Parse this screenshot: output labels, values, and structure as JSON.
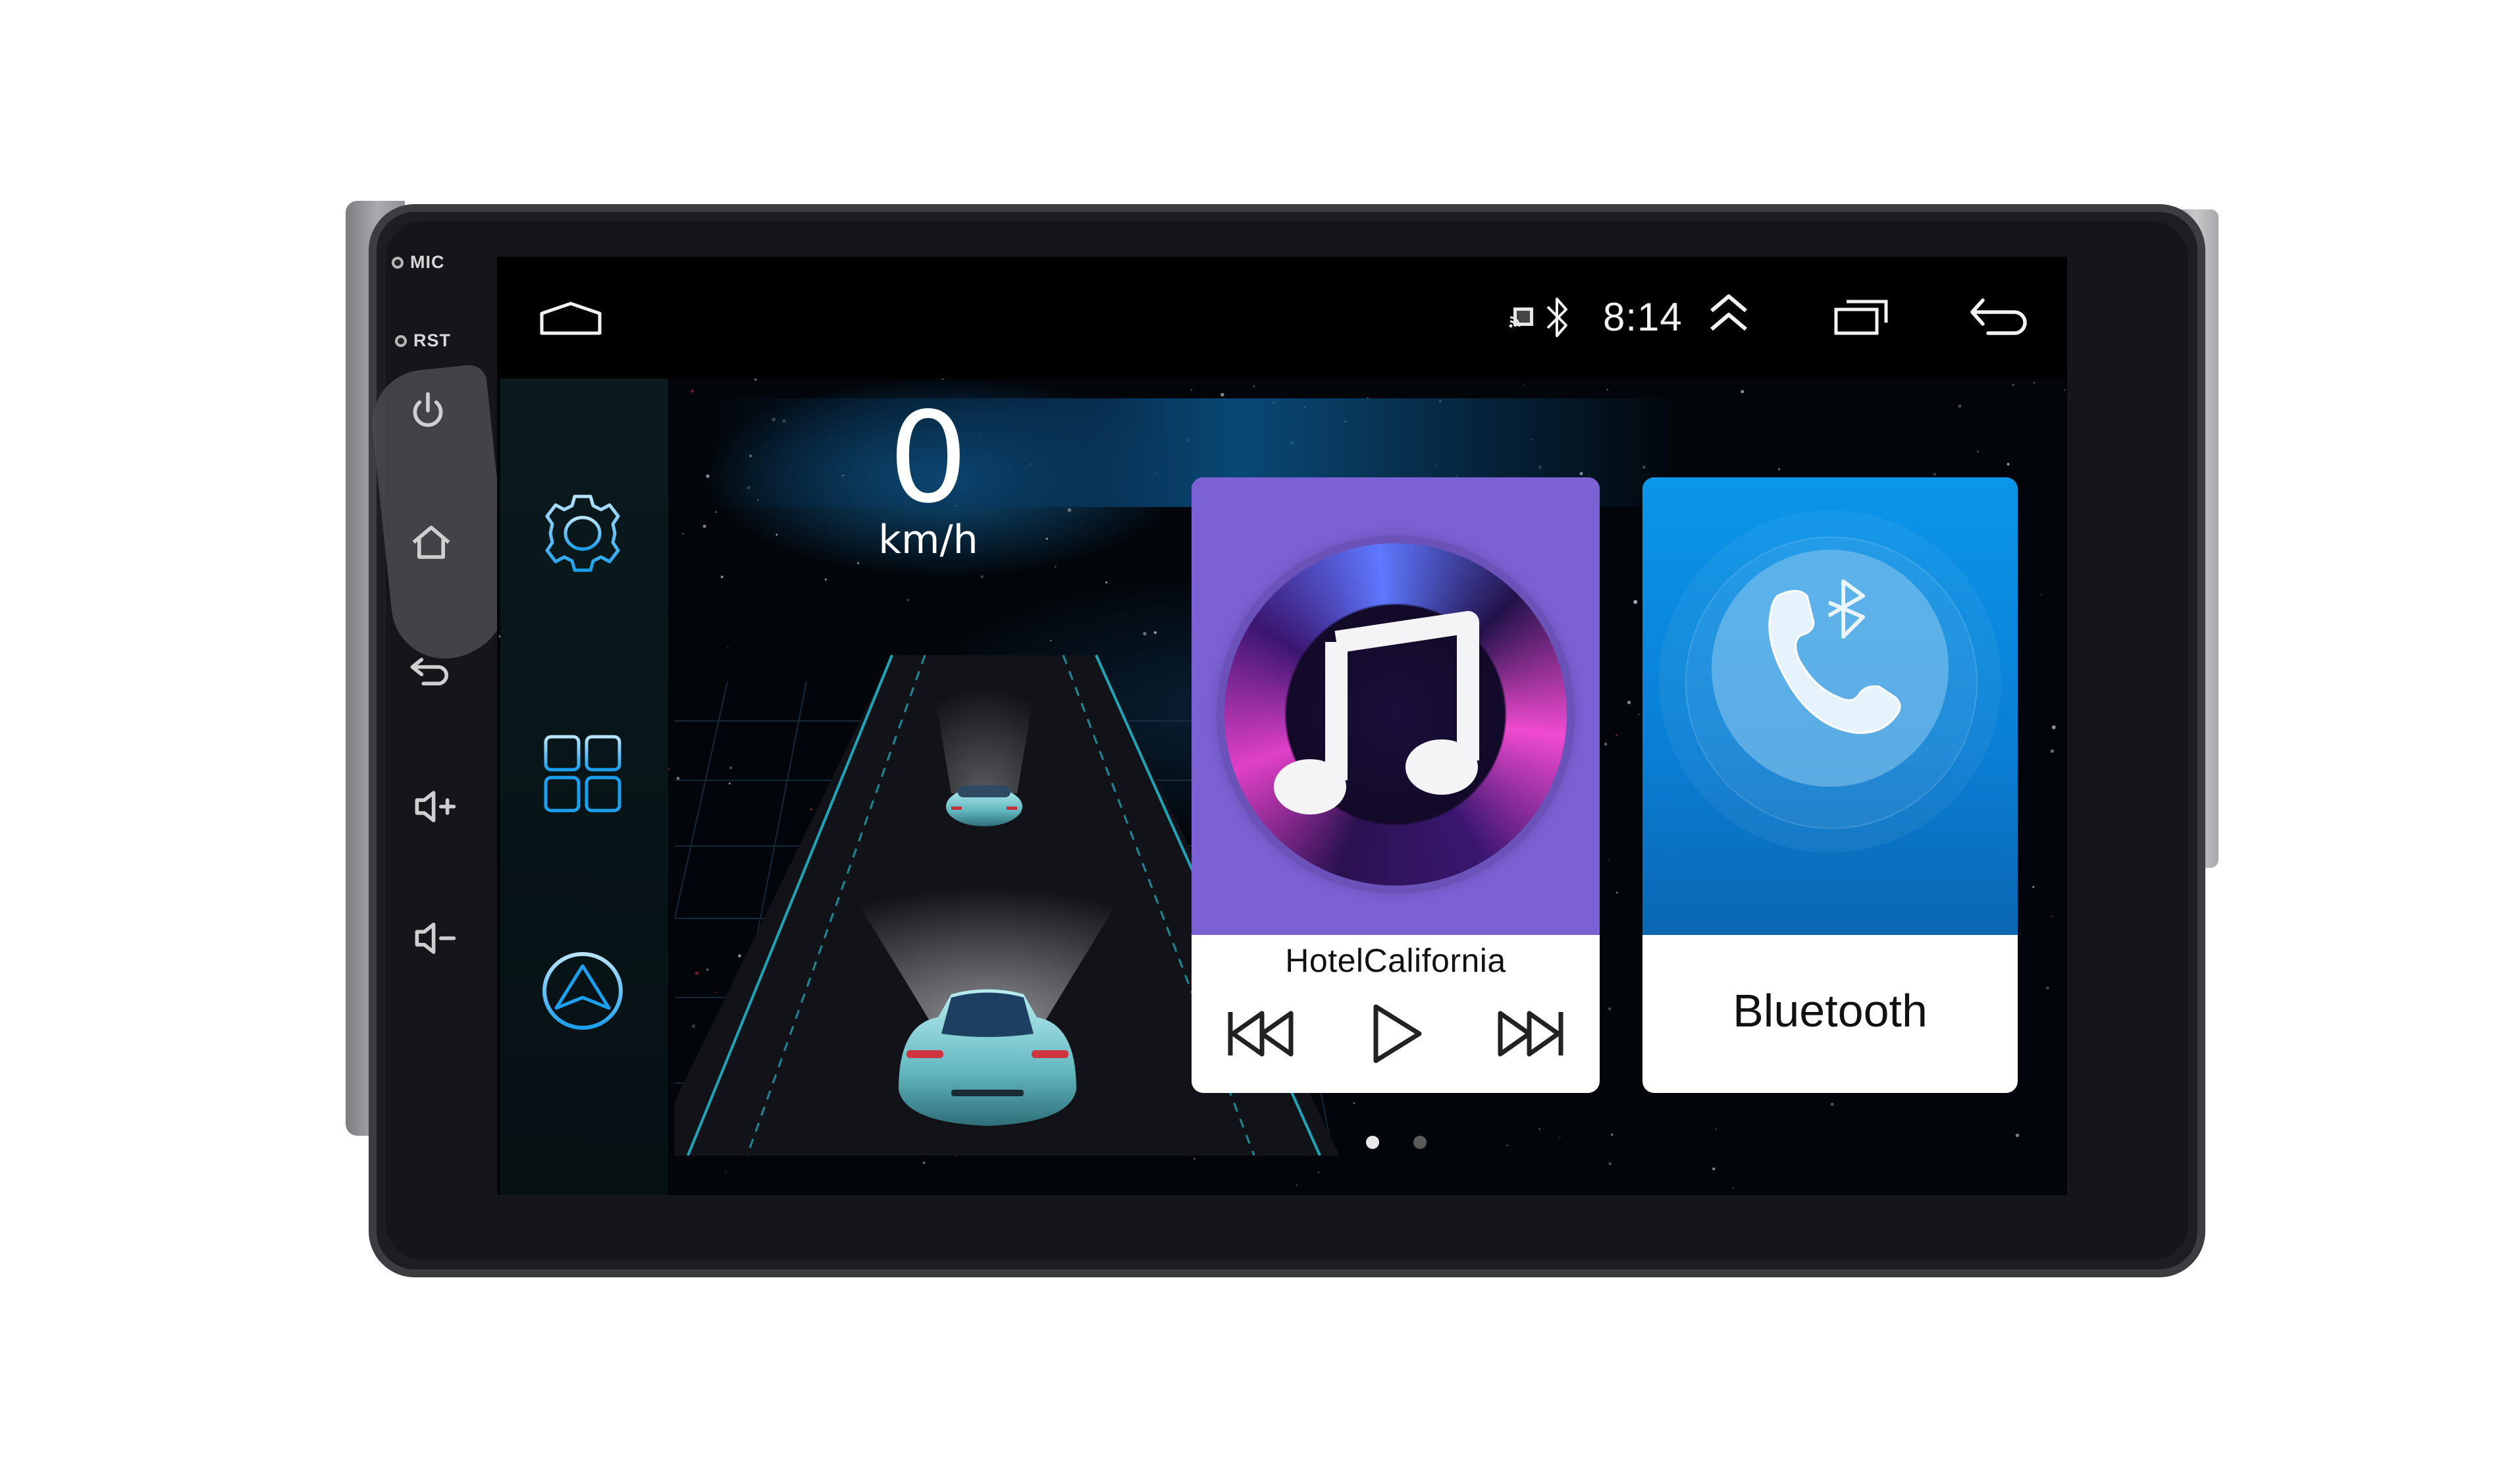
{
  "device": {
    "hardware_labels": {
      "mic": "MIC",
      "rst": "RST"
    },
    "hardware_buttons": [
      {
        "name": "power",
        "icon": "power-icon"
      },
      {
        "name": "home",
        "icon": "home-icon"
      },
      {
        "name": "back",
        "icon": "back-arrow-icon"
      },
      {
        "name": "volume-up",
        "icon": "volume-up-icon"
      },
      {
        "name": "volume-down",
        "icon": "volume-down-icon"
      }
    ]
  },
  "statusbar": {
    "home_icon": "home-outline-icon",
    "cast_icon": "cast-icon",
    "bluetooth_icon": "bluetooth-icon",
    "time": "8:14",
    "expand_icon": "double-chevron-up-icon",
    "recents_icon": "recent-apps-icon",
    "back_icon": "back-arrow-icon"
  },
  "sidebar": {
    "items": [
      {
        "name": "settings",
        "icon": "gear-icon"
      },
      {
        "name": "apps",
        "icon": "app-grid-icon"
      },
      {
        "name": "navigation",
        "icon": "navigation-arrow-icon"
      }
    ]
  },
  "speed_widget": {
    "value": "0",
    "unit": "km/h"
  },
  "music_card": {
    "title": "HotelCalifornia",
    "icon": "music-note-icon",
    "controls": [
      {
        "name": "previous",
        "icon": "skip-previous-icon"
      },
      {
        "name": "play",
        "icon": "play-icon"
      },
      {
        "name": "next",
        "icon": "skip-next-icon"
      }
    ],
    "colors": {
      "art_background": "#7b61d4"
    }
  },
  "bluetooth_card": {
    "label": "Bluetooth",
    "icon": "bluetooth-phone-icon",
    "colors": {
      "art_background": "#0a86dc"
    }
  },
  "pagination": {
    "page_count": 2,
    "active_page": 1
  },
  "colors": {
    "accent": "#1fa6e8",
    "status_text": "#f2f2f2"
  }
}
